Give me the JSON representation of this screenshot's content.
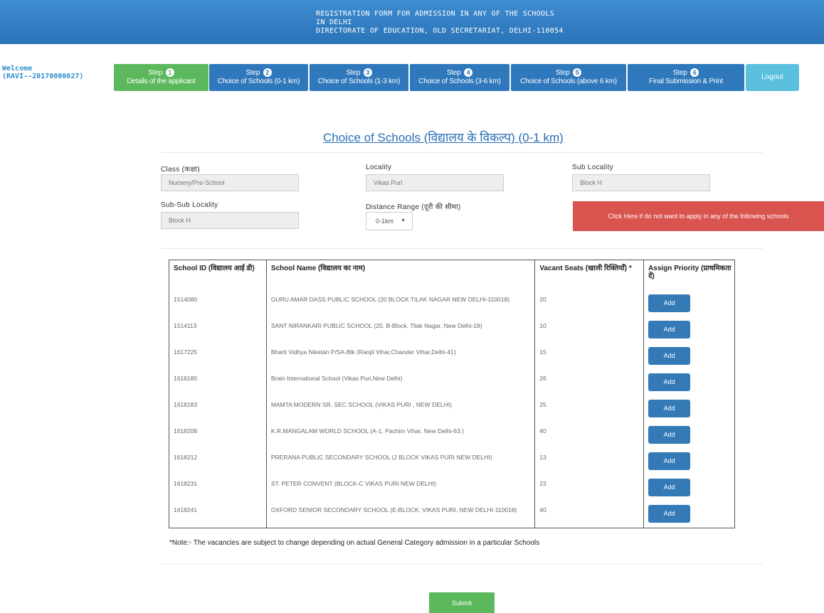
{
  "header": {
    "line1": "REGISTRATION FORM FOR ADMISSION IN ANY OF THE SCHOOLS",
    "line2": "IN DELHI",
    "line3": "DIRECTORATE OF EDUCATION, OLD SECRETARIAT, DELHI-110054"
  },
  "welcome": {
    "label": "Welcome",
    "user": "(RAVI--20170000027)"
  },
  "steps": [
    {
      "prefix": "Step",
      "num": "1",
      "label": "Details of the applicant"
    },
    {
      "prefix": "Step",
      "num": "2",
      "label": "Choice of Schools (0-1 km)"
    },
    {
      "prefix": "Step",
      "num": "3",
      "label": "Choice of Schools (1-3 km)"
    },
    {
      "prefix": "Step",
      "num": "4",
      "label": "Choice of Schools (3-6 km)"
    },
    {
      "prefix": "Step",
      "num": "5",
      "label": "Choice of Schools (above 6 km)"
    },
    {
      "prefix": "Step",
      "num": "6",
      "label": "Final Submission & Print"
    }
  ],
  "logout_label": "Logout",
  "page_title": "Choice of Schools (विद्यालय के विकल्प) (0-1 km)",
  "form": {
    "class_label": "Class (कक्षा)",
    "class_value": "Nursery/Pre-School",
    "locality_label": "Locality",
    "locality_value": "Vikas Puri",
    "sublocality_label": "Sub Locality",
    "sublocality_value": "Block H",
    "subsub_label": "Sub-Sub Locality",
    "subsub_value": "Block H",
    "distance_label": "Distance Range (दूरी की सीमा)",
    "distance_value": "0-1km",
    "optout_label": "Click Here if do not want to apply in any of the following schools"
  },
  "table": {
    "headers": {
      "id": "School ID (विद्यालय आई डी)",
      "name": "School Name (विद्यालय का नाम)",
      "seats": "Vacant Seats (खाली रिक्तियाँ) *",
      "priority": "Assign Priority (प्राथमिकता दें)"
    },
    "add_label": "Add",
    "rows": [
      {
        "id": "1514080",
        "name": "GURU AMAR DASS PUBLIC SCHOOL (20 BLOCK TILAK NAGAR NEW DELHI-110018)",
        "seats": "20"
      },
      {
        "id": "1514113",
        "name": "SANT NIRANKARI PUBLIC SCHOOL (20, B-Block, Tilak Nagar, New Delhi-18)",
        "seats": "10"
      },
      {
        "id": "1617225",
        "name": "Bharti Vidhya Niketan P/SA-Blk (Ranjit Vihar,Chander Vihar,Delhi-41)",
        "seats": "15"
      },
      {
        "id": "1618180",
        "name": "Brain International School (Vikas Puri,New Delhi)",
        "seats": "26"
      },
      {
        "id": "1618183",
        "name": "MAMTA MODERN SR. SEC SCHOOL (VIKAS PURI , NEW DELHI)",
        "seats": "25"
      },
      {
        "id": "1618208",
        "name": "K.R.MANGALAM WORLD SCHOOL (A-1, Pachim Vihar, New Delhi-63.)",
        "seats": "40"
      },
      {
        "id": "1618212",
        "name": "PRERANA PUBLIC SECONDARY SCHOOL (J BLOCK VIKAS PURI NEW DELHI)",
        "seats": "13"
      },
      {
        "id": "1618231",
        "name": "ST. PETER CONVENT (BLOCK-C VIKAS PURI NEW DELHI)",
        "seats": "23"
      },
      {
        "id": "1618241",
        "name": "OXFORD SENIOR SECONDARY SCHOOL (E-BLOCK, VIKAS PURI, NEW DELHI-110018)",
        "seats": "40"
      }
    ]
  },
  "note": "*Note:- The vacancies are subject to change depending on actual General Category admission in a particular Schools",
  "submit_label": "Submit",
  "colors": {
    "header": "#2f7bc1",
    "step_active": "#5cb85c",
    "step": "#2f78bc",
    "logout": "#5bc0de",
    "danger": "#d9534f"
  }
}
